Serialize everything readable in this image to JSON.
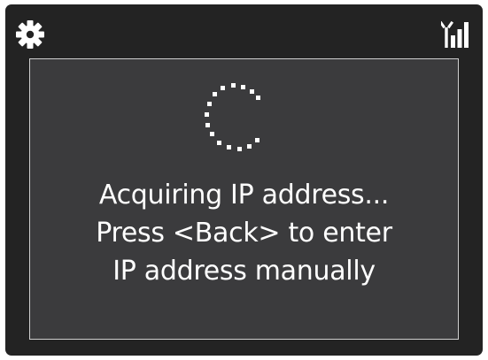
{
  "status_bar": {
    "left_icon": "gear-icon",
    "right_icon": "wifi-signal-icon"
  },
  "dialog": {
    "spinner_icon": "loading-spinner-icon",
    "lines": [
      "Acquiring IP address...",
      "Press <Back> to enter",
      "IP address manually"
    ]
  },
  "colors": {
    "frame": "#232323",
    "panel": "#3b3b3d",
    "panel_border": "#cfcfcf",
    "text": "#ffffff"
  }
}
